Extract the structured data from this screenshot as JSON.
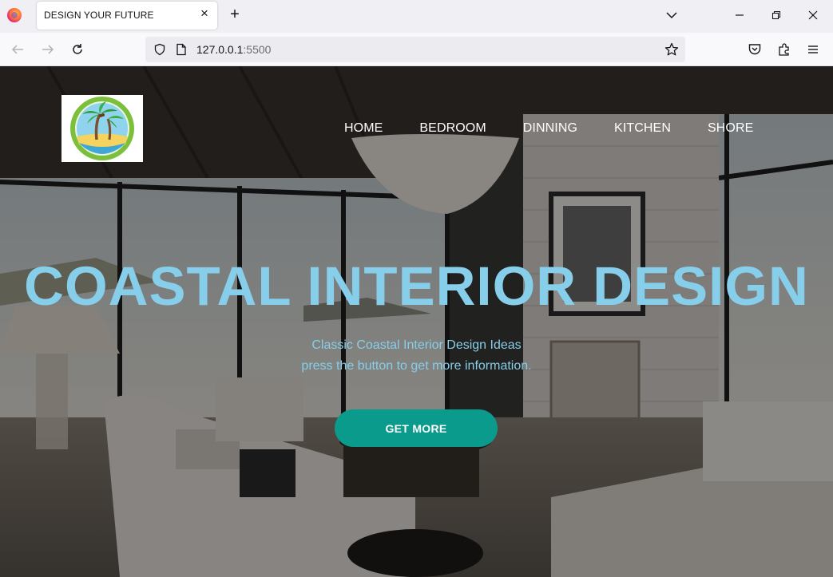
{
  "browser": {
    "tab_title": "DESIGN YOUR FUTURE",
    "url_host": "127.0.0.1",
    "url_port": ":5500"
  },
  "site": {
    "nav": [
      "HOME",
      "BEDROOM",
      "DINNING",
      "KITCHEN",
      "SHORE"
    ],
    "hero": {
      "title": "COASTAL INTERIOR DESIGN",
      "subtitle_line1": "Classic Coastal Interior Design Ideas",
      "subtitle_line2": "press the button to get more information.",
      "cta_label": "GET MORE"
    }
  },
  "colors": {
    "accent": "#87ceeb",
    "cta": "#0b9b8d"
  }
}
